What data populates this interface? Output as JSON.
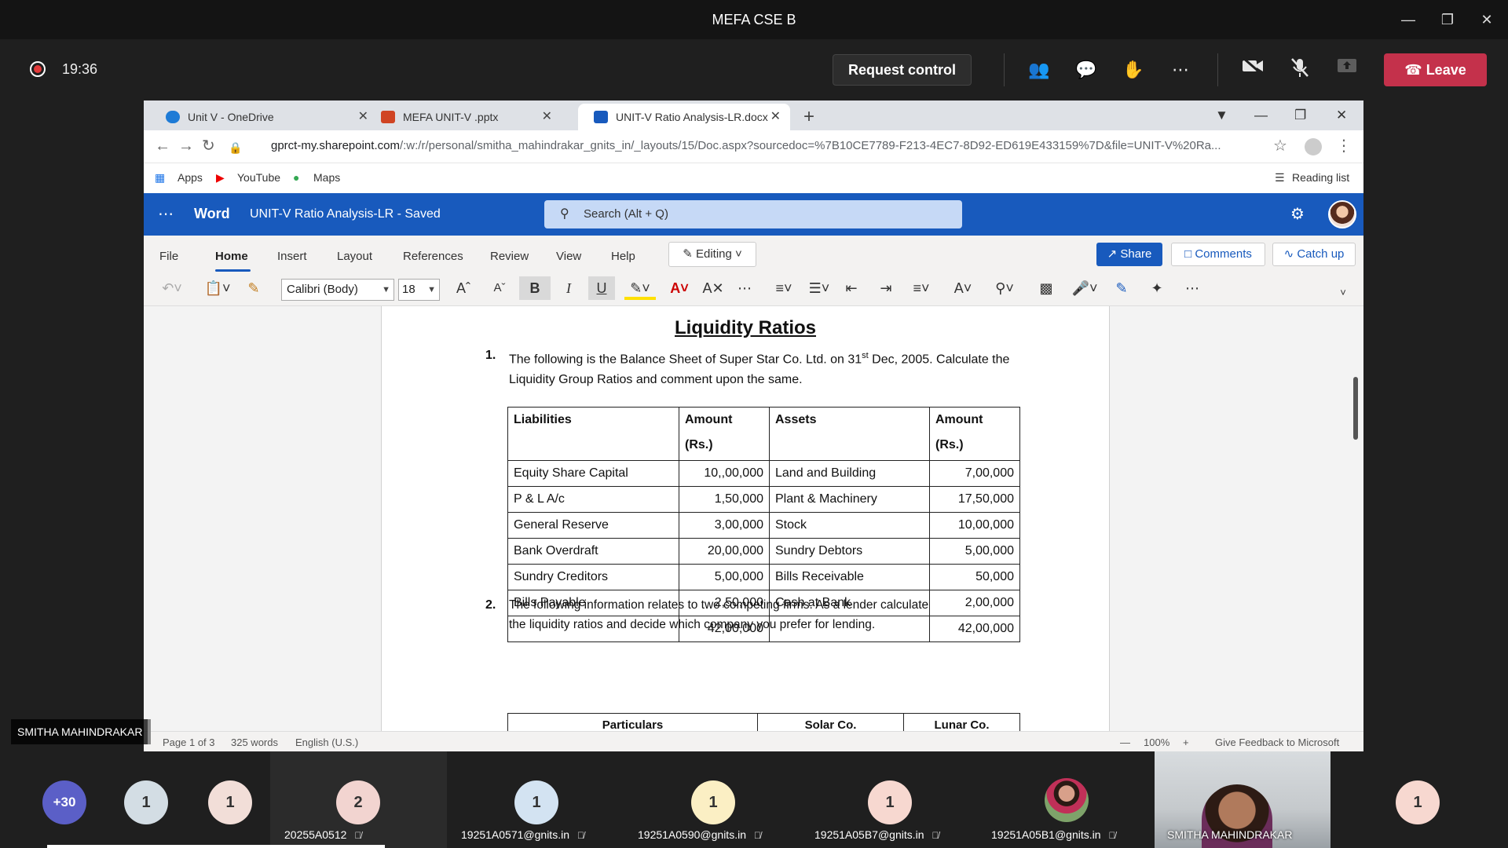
{
  "teams": {
    "title": "MEFA CSE B",
    "timer": "19:36",
    "request_control_label": "Request control",
    "leave_label": "Leave",
    "tools": [
      "people-icon",
      "chat-icon",
      "react-icon",
      "more-icon",
      "camera-off-icon",
      "mic-off-icon",
      "share-icon"
    ]
  },
  "browser": {
    "tabs": [
      {
        "label": "Unit V - OneDrive"
      },
      {
        "label": "MEFA UNIT-V .pptx"
      },
      {
        "label": "UNIT-V Ratio Analysis-LR.docx"
      }
    ],
    "url_host": "gprct-my.sharepoint.com",
    "url_path": "/:w:/r/personal/smitha_mahindrakar_gnits_in/_layouts/15/Doc.aspx?sourcedoc=%7B10CE7789-F213-4EC7-8D92-ED619E433159%7D&file=UNIT-V%20Ra...",
    "bookmarks": [
      "Apps",
      "YouTube",
      "Maps"
    ],
    "reading_list": "Reading list"
  },
  "word": {
    "app_name": "Word",
    "doc_title": "UNIT-V Ratio Analysis-LR  -  Saved",
    "search_placeholder": "Search (Alt + Q)",
    "menus": [
      "File",
      "Home",
      "Insert",
      "Layout",
      "References",
      "Review",
      "View",
      "Help"
    ],
    "editing_label": "Editing",
    "share_label": "Share",
    "comments_label": "Comments",
    "catchup_label": "Catch up",
    "font_name": "Calibri (Body)",
    "font_size": "18"
  },
  "document": {
    "heading": "Liquidity Ratios",
    "q1_num": "1.",
    "q1_text_a": "The following is the Balance Sheet of Super Star Co. Ltd. on 31",
    "q1_sup": "st",
    "q1_text_b": " Dec, 2005. Calculate the Liquidity Group Ratios and comment upon the same.",
    "table_headers": {
      "liabilities": "Liabilities",
      "amount": "Amount",
      "rs": "(Rs.)",
      "assets": "Assets"
    },
    "rows": [
      [
        "Equity Share Capital",
        "10,,00,000",
        "Land and Building",
        "7,00,000"
      ],
      [
        "P & L A/c",
        "1,50,000",
        "Plant & Machinery",
        "17,50,000"
      ],
      [
        "General Reserve",
        "3,00,000",
        "Stock",
        "10,00,000"
      ],
      [
        "Bank Overdraft",
        "20,00,000",
        "Sundry Debtors",
        "5,00,000"
      ],
      [
        "Sundry Creditors",
        "5,00,000",
        "Bills Receivable",
        "50,000"
      ],
      [
        "Bills Payable",
        "2,50,000",
        "Cash at Bank",
        "2,00,000"
      ],
      [
        "",
        "42,00,000",
        "",
        "42,00,000"
      ]
    ],
    "q2_num": "2.",
    "q2_text": "The following information relates to two competing firms.  As a lender  calculate the liquidity ratios and  decide which company you prefer for lending.",
    "cmp_headers": [
      "Particulars",
      "Solar Co.",
      "Lunar Co."
    ]
  },
  "status": {
    "page": "Page 1 of 3",
    "words": "325 words",
    "language": "English (U.S.)",
    "zoom": "100%",
    "feedback": "Give Feedback to Microsoft"
  },
  "presenter_label": "SMITHA MAHINDRAKAR",
  "participants": [
    {
      "badge": "+30",
      "color": "#5b5fc7",
      "name": ""
    },
    {
      "badge": "1",
      "color": "#d3dde4",
      "name": ""
    },
    {
      "badge": "1",
      "color": "#f2ded8",
      "name": ""
    },
    {
      "badge": "2",
      "color": "#f2d4d0",
      "name": "20255A0512"
    },
    {
      "badge": "1",
      "color": "#d3e3f2",
      "name": "19251A0571@gnits.in"
    },
    {
      "badge": "1",
      "color": "#fbefc4",
      "name": "19251A0590@gnits.in"
    },
    {
      "badge": "1",
      "color": "#f7d8d0",
      "name": "19251A05B7@gnits.in"
    },
    {
      "badge": "",
      "color": "#8aa27a",
      "name": "19251A05B1@gnits.in"
    },
    {
      "badge": "1",
      "color": "#f7d8d0",
      "name": ""
    }
  ],
  "video_name": "SMITHA MAHINDRAKAR"
}
